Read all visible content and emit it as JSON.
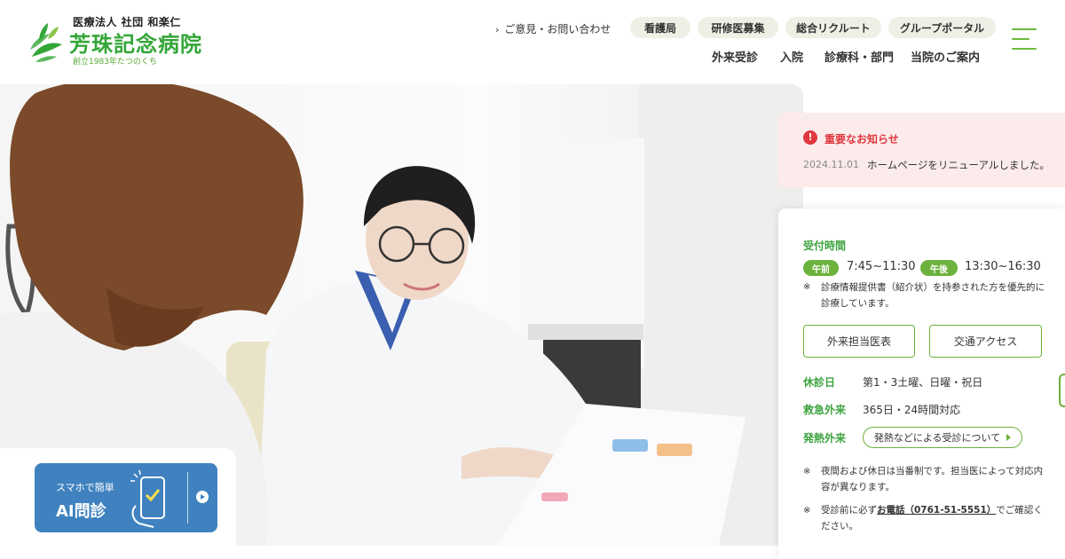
{
  "header": {
    "logo": {
      "corporation": "医療法人 社団 和楽仁",
      "hospital_name": "芳珠記念病院",
      "founded": "創立1983年たつのくち"
    },
    "contact_link": "ご意見・お問い合わせ",
    "pills": [
      "看護局",
      "研修医募集",
      "総合リクルート",
      "グループポータル"
    ],
    "nav": [
      "外来受診",
      "入院",
      "診療科・部門",
      "当院のご案内"
    ],
    "menu_icon": "hamburger-icon",
    "accent_color": "#6cbb3c"
  },
  "ai_banner": {
    "line1": "スマホで簡単",
    "line2": "AI問診",
    "icon": "smartphone-check-icon",
    "color": "#3f82bf"
  },
  "notice": {
    "title": "重要なお知らせ",
    "icon": "alert-icon",
    "date": "2024.11.01",
    "text": "ホームページをリニューアルしました。",
    "color": "#e0383e"
  },
  "info": {
    "reception_label": "受付時間",
    "am_label": "午前",
    "am_hours": "7:45~11:30",
    "pm_label": "午後",
    "pm_hours": "13:30~16:30",
    "note_mark": "※",
    "referral_note": "診療情報提供書（紹介状）を持参された方を優先的に診療しています。",
    "doctor_button": "外来担当医表",
    "access_button": "交通アクセス",
    "closed_label": "休診日",
    "closed_value": "第1・3土曜、日曜・祝日",
    "emergency_label": "救急外来",
    "emergency_value": "365日・24時間対応",
    "fever_label": "発熱外来",
    "fever_button": "発熱などによる受診について",
    "night_note": "夜間および休日は当番制です。担当医によって対応内容が異なります。",
    "call_note_prefix": "受診前に必ず",
    "call_note_link": "お電話（0761-51-5551）",
    "call_note_suffix": "でご確認ください。",
    "accent_color": "#6cb23d"
  }
}
